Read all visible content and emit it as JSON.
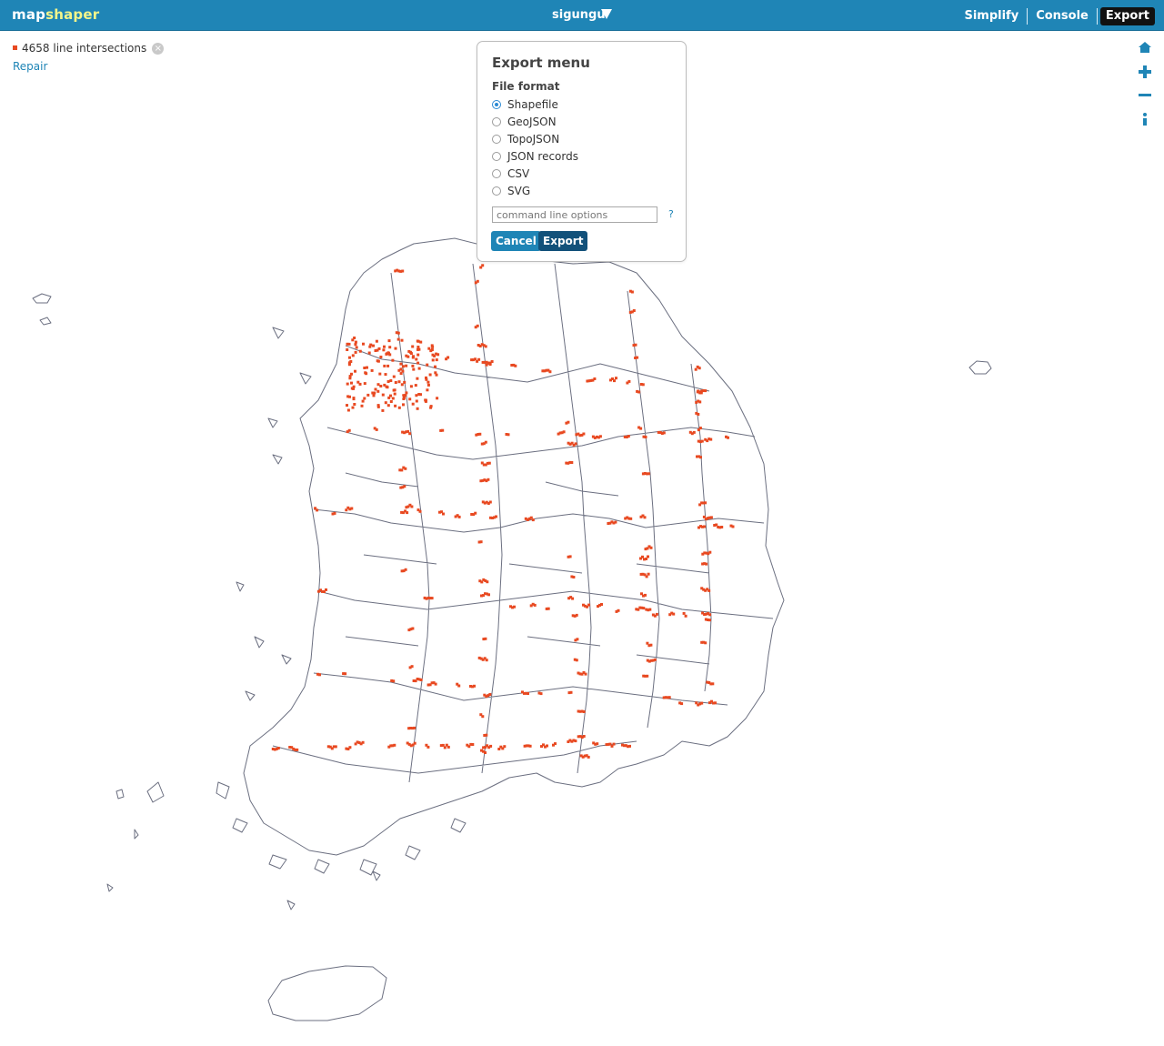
{
  "app": {
    "logo_part1": "map",
    "logo_part2": "shaper",
    "layer_name": "sigungu"
  },
  "nav": {
    "simplify": "Simplify",
    "console": "Console",
    "export": "Export",
    "active": "Export"
  },
  "status": {
    "intersections_text": "4658 line intersections",
    "repair_label": "Repair"
  },
  "tools": [
    "home-icon",
    "zoom-in-icon",
    "zoom-out-icon",
    "info-icon"
  ],
  "export_menu": {
    "title": "Export menu",
    "subtitle": "File format",
    "formats": [
      {
        "label": "Shapefile",
        "selected": true
      },
      {
        "label": "GeoJSON",
        "selected": false
      },
      {
        "label": "TopoJSON",
        "selected": false
      },
      {
        "label": "JSON records",
        "selected": false
      },
      {
        "label": "CSV",
        "selected": false
      },
      {
        "label": "SVG",
        "selected": false
      }
    ],
    "options_placeholder": "command line options",
    "help_label": "?",
    "cancel_label": "Cancel",
    "export_label": "Export"
  },
  "colors": {
    "topbar": "#1f85b6",
    "intersection": "#e84921",
    "boundary": "#6b6f80",
    "accent": "#2b8ad4"
  }
}
